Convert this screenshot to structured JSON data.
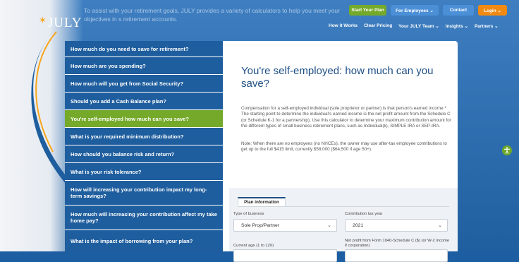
{
  "intro_text": "To assist with your retirement goals, JULY provides a variety of calculators to help you meet your objectives in s retirement accounts.",
  "logo_text": "JULY",
  "top_buttons": {
    "start": "Start Your Plan",
    "employees": "For Employees ⌄",
    "contact": "Contact",
    "login": "Login ⌄"
  },
  "nav": [
    "How it Works",
    "Clear Pricing",
    "Your JULY Team ⌄",
    "Insights ⌄",
    "Partners ⌄"
  ],
  "sidebar": {
    "items": [
      "How much do you need to save for retirement?",
      "How much are you spending?",
      "How much will you get from Social Security?",
      "Should you add a Cash Balance plan?",
      "You're self-employed how much can you save?",
      "What is your required minimum distribution?",
      "How should you balance risk and return?",
      "What is your risk tolerance?",
      "How will increasing your contribution impact my long-term savings?",
      "How much will increasing your contribution affect my take home pay?",
      "What is the impact of borrowing from your plan?"
    ],
    "active_index": 4
  },
  "main": {
    "title": "You're self-employed: how much can you save?",
    "paragraph1": "Compensation for a self-employed individual (sole proprietor or partner) is that person's earned income.* The starting point to determine the individual's earned income is the net profit amount from the Schedule C (or Schedule K-1 for a partnership). Use this calculator to determine your maximum contribution amount for the different types of small business retirement plans, such as Individual(k), SIMPLE IRA or SEP-IRA.",
    "paragraph2": "Note: When there are no employees (no NHCEs), the owner may use after-tax employee contributions to get up to the full $415 limit, currently $58,000 ($64,500 if age 50+)."
  },
  "form": {
    "tab_label": "Plan information",
    "business_type_label": "Type of business",
    "business_type_value": "Sole Prop/Partner",
    "tax_year_label": "Contribution tax year",
    "tax_year_value": "2021",
    "age_label": "Current age (1 to 120)",
    "net_profit_label": "Net profit from Form 1040-Schedule C ($) (or W-2 income if corporation)"
  },
  "colors": {
    "brand_blue": "#1f5e9e",
    "accent_green": "#75a92a",
    "login_orange": "#f28a12",
    "title_blue": "#1e4f86"
  }
}
